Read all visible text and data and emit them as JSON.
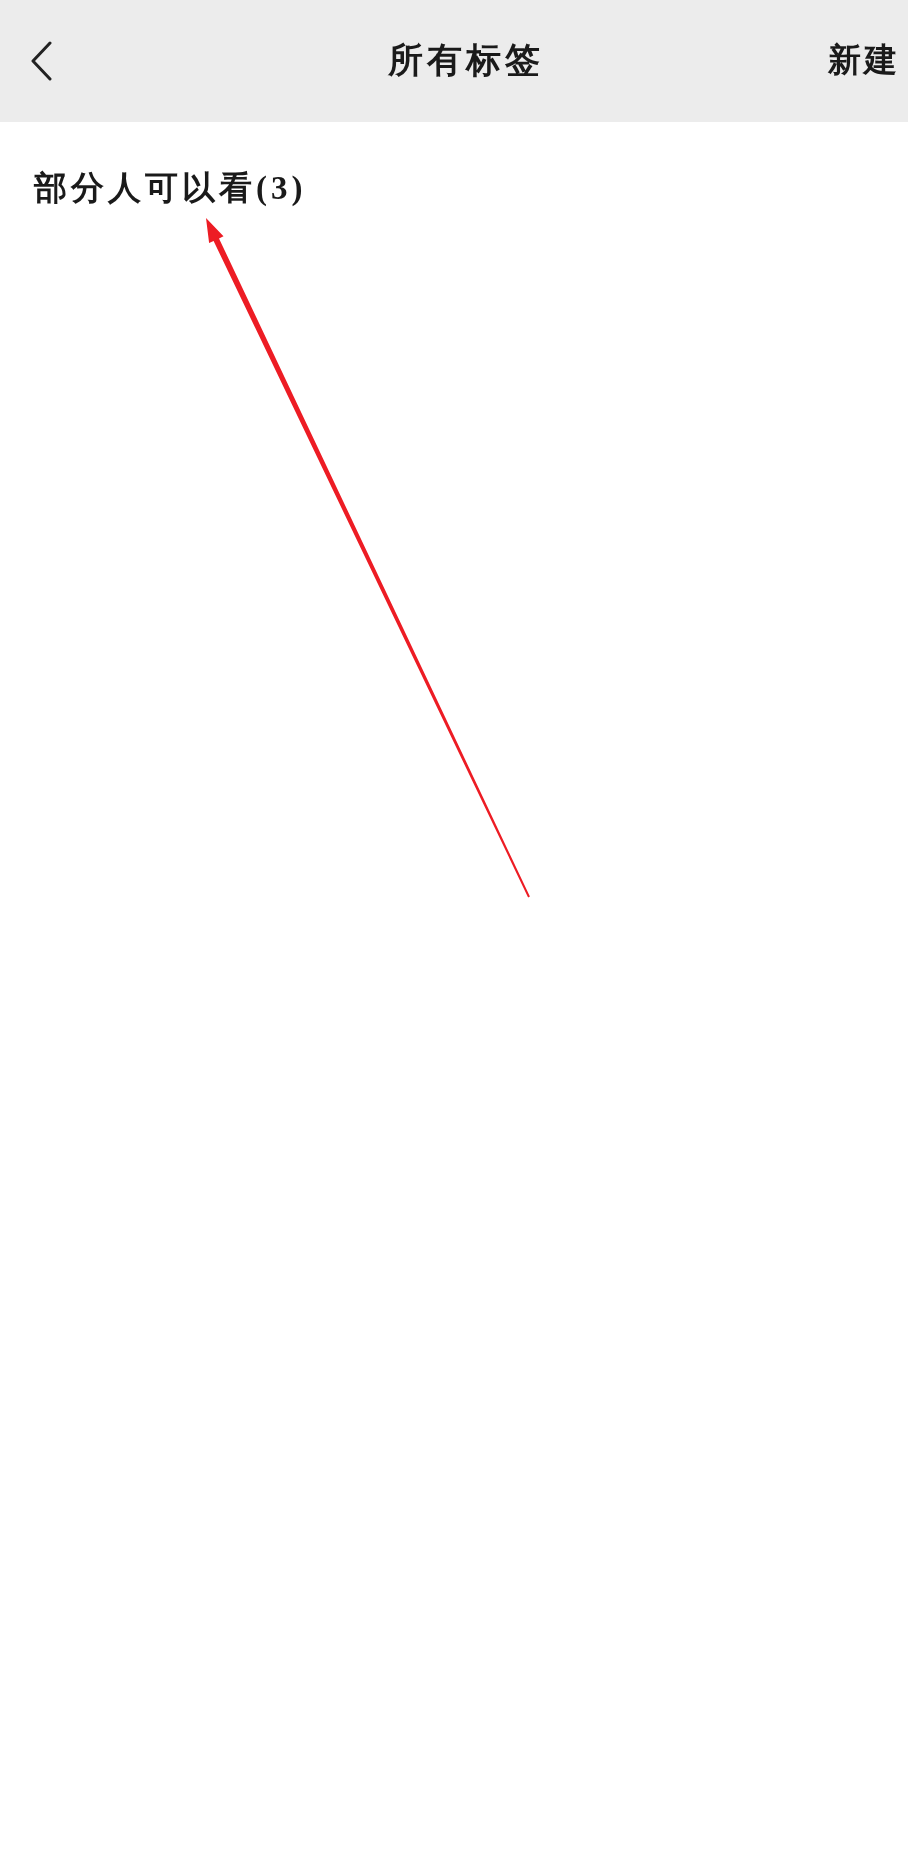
{
  "header": {
    "title": "所有标签",
    "action": "新建"
  },
  "tags": [
    {
      "label": "部分人可以看(3)"
    }
  ]
}
